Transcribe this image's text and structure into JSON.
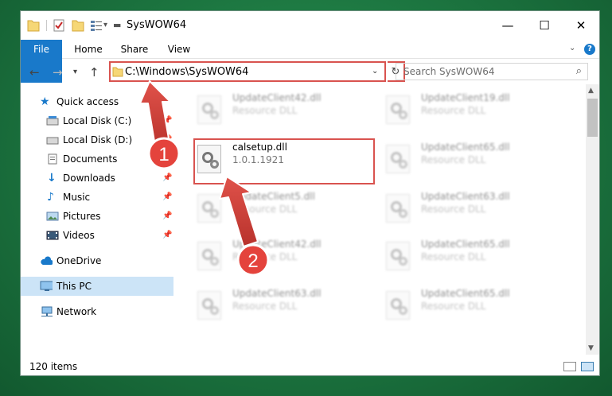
{
  "window": {
    "title": "SysWOW64",
    "minimize_glyph": "—",
    "maximize_glyph": "☐",
    "close_glyph": "✕"
  },
  "ribbon": {
    "tabs": [
      "File",
      "Home",
      "Share",
      "View"
    ],
    "help_glyph": "?"
  },
  "address": {
    "path": "C:\\Windows\\SysWOW64",
    "search_placeholder": "Search SysWOW64"
  },
  "sidebar": {
    "items": [
      {
        "label": "Quick access",
        "icon": "star-icon",
        "pinned": false
      },
      {
        "label": "Local Disk (C:)",
        "icon": "drive-icon",
        "pinned": true
      },
      {
        "label": "Local Disk (D:)",
        "icon": "drive-icon",
        "pinned": true
      },
      {
        "label": "Documents",
        "icon": "documents-icon",
        "pinned": true
      },
      {
        "label": "Downloads",
        "icon": "download-icon",
        "pinned": true
      },
      {
        "label": "Music",
        "icon": "music-icon",
        "pinned": true
      },
      {
        "label": "Pictures",
        "icon": "pictures-icon",
        "pinned": true
      },
      {
        "label": "Videos",
        "icon": "videos-icon",
        "pinned": true
      },
      {
        "label": "OneDrive",
        "icon": "cloud-icon",
        "pinned": false
      },
      {
        "label": "This PC",
        "icon": "computer-icon",
        "pinned": false
      },
      {
        "label": "Network",
        "icon": "network-icon",
        "pinned": false
      }
    ]
  },
  "files": {
    "left_column": [
      {
        "name": "UpdateClient42.dll",
        "desc": "Resource DLL"
      },
      {
        "name": "calsetup.dll",
        "desc": "1.0.1.1921"
      },
      {
        "name": "UpdateClient5.dll",
        "desc": "Resource DLL"
      },
      {
        "name": "UpdateClient42.dll",
        "desc": "Resource DLL"
      },
      {
        "name": "UpdateClient63.dll",
        "desc": "Resource DLL"
      }
    ],
    "right_column": [
      {
        "name": "UpdateClient19.dll",
        "desc": "Resource DLL"
      },
      {
        "name": "UpdateClient65.dll",
        "desc": "Resource DLL"
      },
      {
        "name": "UpdateClient63.dll",
        "desc": "Resource DLL"
      },
      {
        "name": "UpdateClient65.dll",
        "desc": "Resource DLL"
      },
      {
        "name": "UpdateClient65.dll",
        "desc": "Resource DLL"
      }
    ]
  },
  "status": {
    "item_count": "120 items"
  },
  "annotations": {
    "step1": "1",
    "step2": "2"
  },
  "colors": {
    "accent": "#1979ca",
    "highlight_red": "#d9534f",
    "selection": "#cce4f7"
  }
}
